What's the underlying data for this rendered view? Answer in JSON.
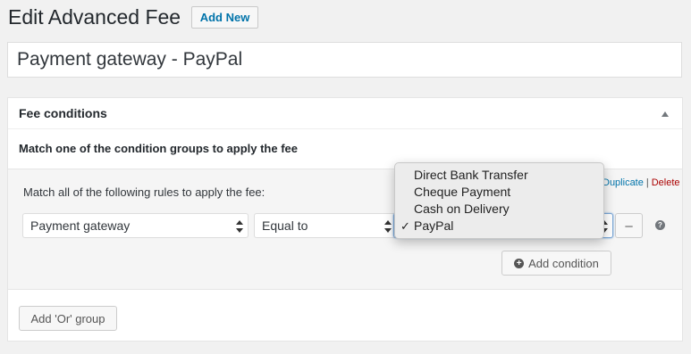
{
  "page": {
    "title": "Edit Advanced Fee",
    "add_new_label": "Add New"
  },
  "title_field": {
    "value": "Payment gateway - PayPal"
  },
  "postbox": {
    "title": "Fee conditions",
    "intro": "Match one of the condition groups to apply the fee"
  },
  "group": {
    "description": "Match all of the following rules to apply the fee:",
    "duplicate_label": "Duplicate",
    "separator": "|",
    "delete_label": "Delete",
    "condition": {
      "field": "Payment gateway",
      "operator": "Equal to",
      "value": "PayPal"
    },
    "minus_label": "–",
    "help_label": "?",
    "add_condition_label": "Add condition"
  },
  "add_or_group_label": "Add 'Or' group",
  "dropdown": {
    "options": [
      {
        "label": "Direct Bank Transfer",
        "selected": false
      },
      {
        "label": "Cheque Payment",
        "selected": false
      },
      {
        "label": "Cash on Delivery",
        "selected": false
      },
      {
        "label": "PayPal",
        "selected": true
      }
    ],
    "check_mark": "✓"
  },
  "colors": {
    "link": "#0073aa",
    "delete": "#aa0000",
    "background": "#f1f1f1"
  }
}
